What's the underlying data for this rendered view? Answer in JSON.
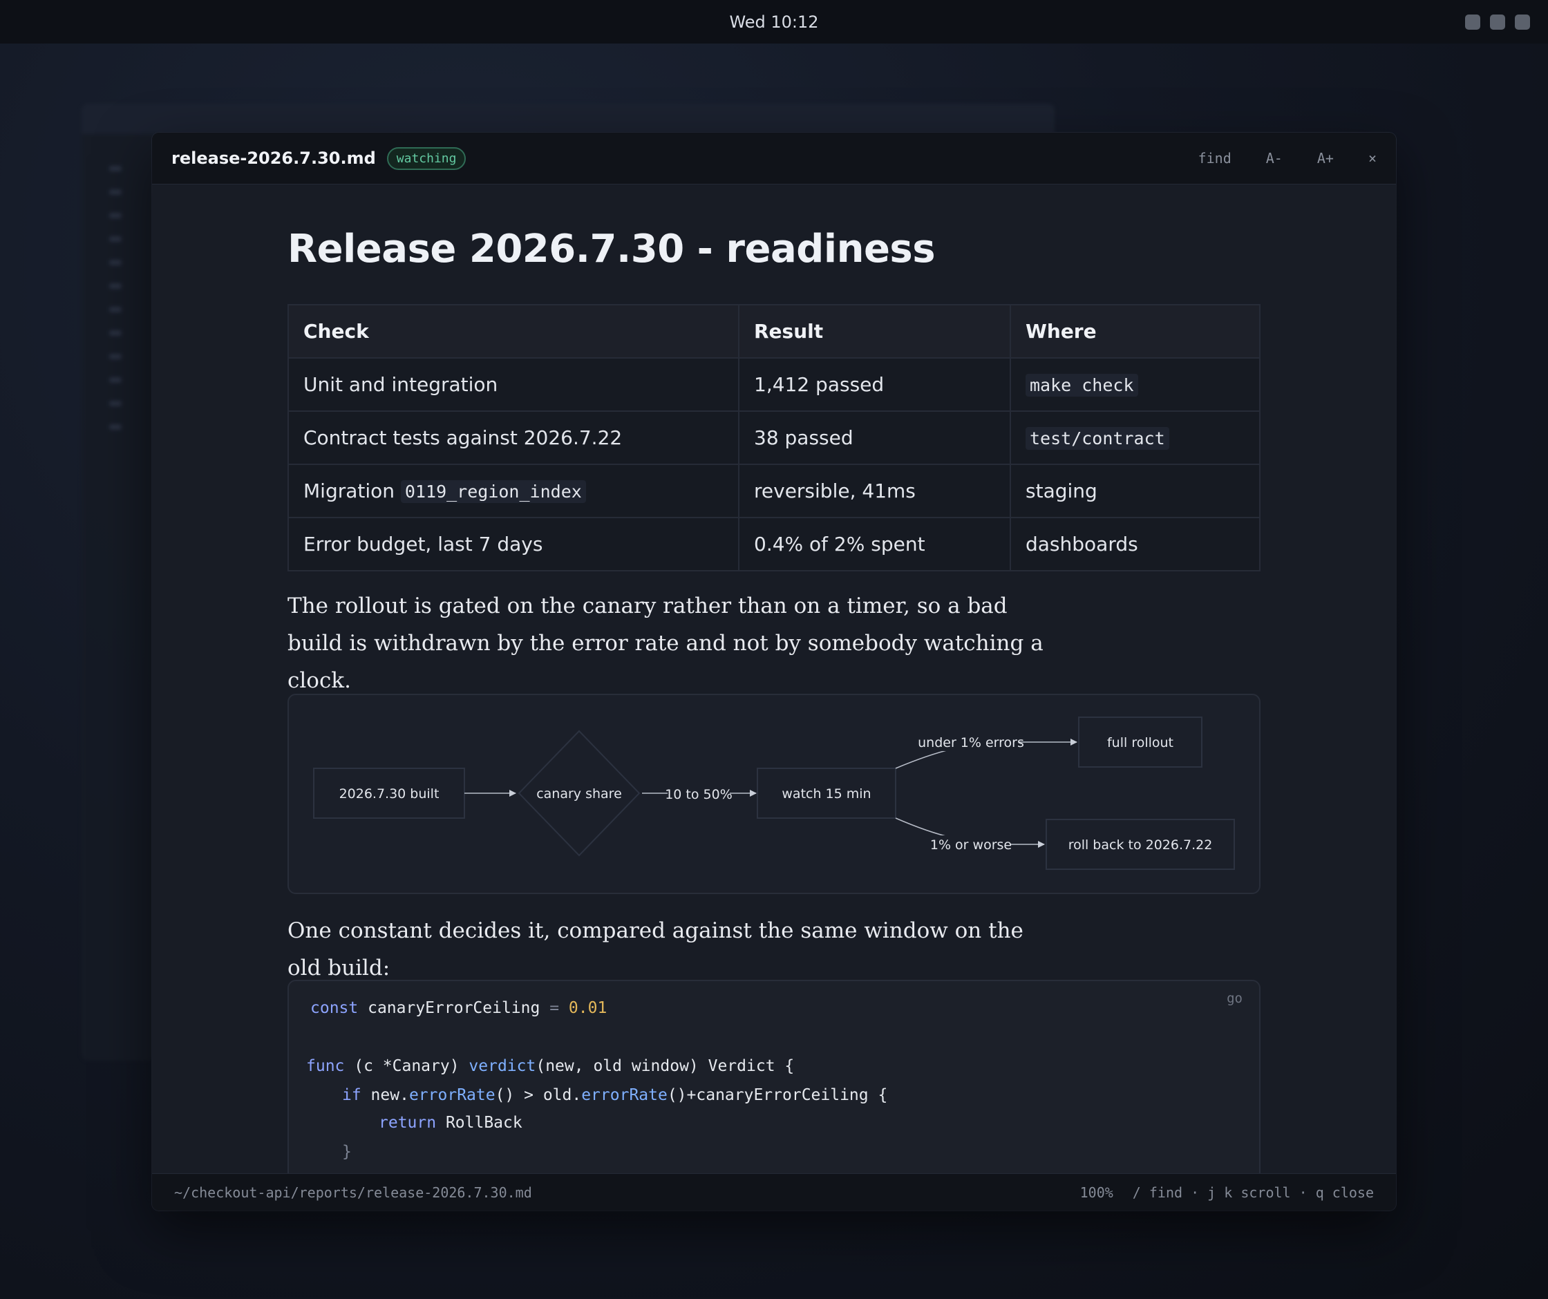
{
  "system": {
    "clock": "Wed 10:12"
  },
  "window": {
    "filename": "release-2026.7.30.md",
    "badge": "watching",
    "buttons": {
      "find": "find",
      "font_down": "A-",
      "font_up": "A+",
      "close": "×"
    }
  },
  "doc": {
    "title": "Release 2026.7.30 - readiness",
    "table": {
      "headers": [
        "Check",
        "Result",
        "Where"
      ],
      "rows": [
        {
          "check": "Unit and integration",
          "check_code": "",
          "result": "1,412 passed",
          "where": "make check",
          "where_code": true
        },
        {
          "check": "Contract tests against 2026.7.22",
          "check_code": "",
          "result": "38 passed",
          "where": "test/contract",
          "where_code": true
        },
        {
          "check": "Migration ",
          "check_code": "0119_region_index",
          "result": "reversible, 41ms",
          "where": "staging",
          "where_code": false
        },
        {
          "check": "Error budget, last 7 days",
          "check_code": "",
          "result": "0.4% of 2% spent",
          "where": "dashboards",
          "where_code": false
        }
      ]
    },
    "para1": "The rollout is gated on the canary rather than on a timer, so a bad build is withdrawn by the error rate and not by somebody watching a clock.",
    "diagram": {
      "built": "2026.7.30 built",
      "canary": "canary share",
      "edge_share": "10 to 50%",
      "watch": "watch 15 min",
      "edge_ok": "under 1% errors",
      "full": "full rollout",
      "edge_bad": "1% or worse",
      "rollback": "roll back to 2026.7.22"
    },
    "para2": "One constant decides it, compared against the same window on the old build:",
    "code": {
      "lang": "go",
      "l1_kw": "const",
      "l1_name": " canaryErrorCeiling ",
      "l1_eq": "=",
      "l1_num": " 0.01",
      "l2_kw": "func",
      "l2_recv": "(c *Canary) ",
      "l2_fn": "verdict",
      "l2_args": "(new, old window) Verdict {",
      "l3_kw": "if",
      "l3_a": " new.",
      "l3_fn1": "errorRate",
      "l3_b": "() > old.",
      "l3_fn2": "errorRate",
      "l3_c": "()+canaryErrorCeiling {",
      "l4_kw": "return",
      "l4_val": " RollBack",
      "l5": "}"
    }
  },
  "status": {
    "path": "~/checkout-api/reports/release-2026.7.30.md",
    "zoom": "100%",
    "hints": "/ find · j k scroll · q close"
  }
}
